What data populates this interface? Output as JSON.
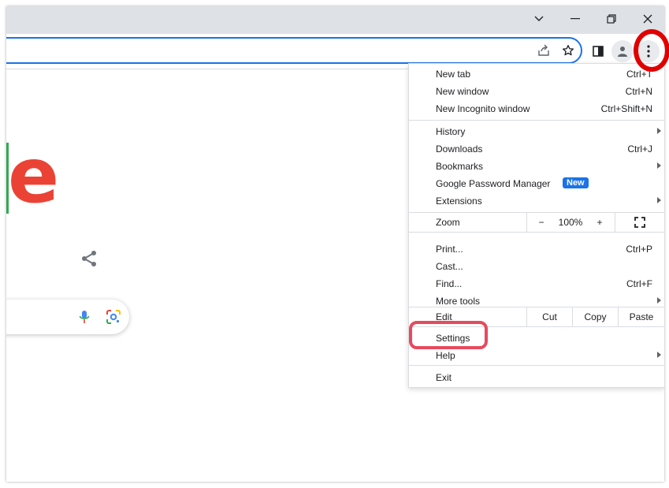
{
  "window": {
    "dropdown_icon": "chevron-down-icon",
    "minimize_icon": "minimize-icon",
    "restore_icon": "restore-icon",
    "close_icon": "close-icon"
  },
  "toolbar": {
    "share_icon": "share-page-icon",
    "bookmark_icon": "star-icon",
    "side_panel_icon": "side-panel-icon",
    "profile_icon": "profile-icon",
    "menu_icon": "kebab-menu-icon"
  },
  "page": {
    "logo_letter": "e",
    "logo_color": "#ea4335"
  },
  "menu": {
    "new_tab": {
      "label": "New tab",
      "shortcut": "Ctrl+T"
    },
    "new_window": {
      "label": "New window",
      "shortcut": "Ctrl+N"
    },
    "new_incognito": {
      "label": "New Incognito window",
      "shortcut": "Ctrl+Shift+N"
    },
    "history": {
      "label": "History"
    },
    "downloads": {
      "label": "Downloads",
      "shortcut": "Ctrl+J"
    },
    "bookmarks": {
      "label": "Bookmarks"
    },
    "password_manager": {
      "label": "Google Password Manager",
      "badge": "New"
    },
    "extensions": {
      "label": "Extensions"
    },
    "zoom": {
      "label": "Zoom",
      "minus": "−",
      "value": "100%",
      "plus": "+"
    },
    "print": {
      "label": "Print...",
      "shortcut": "Ctrl+P"
    },
    "cast": {
      "label": "Cast..."
    },
    "find": {
      "label": "Find...",
      "shortcut": "Ctrl+F"
    },
    "more_tools": {
      "label": "More tools"
    },
    "edit": {
      "label": "Edit",
      "cut": "Cut",
      "copy": "Copy",
      "paste": "Paste"
    },
    "settings": {
      "label": "Settings"
    },
    "help": {
      "label": "Help"
    },
    "exit": {
      "label": "Exit"
    }
  },
  "colors": {
    "accent": "#1a73e8",
    "highlight_settings": "#e64b5d",
    "highlight_menu": "#e00000"
  }
}
